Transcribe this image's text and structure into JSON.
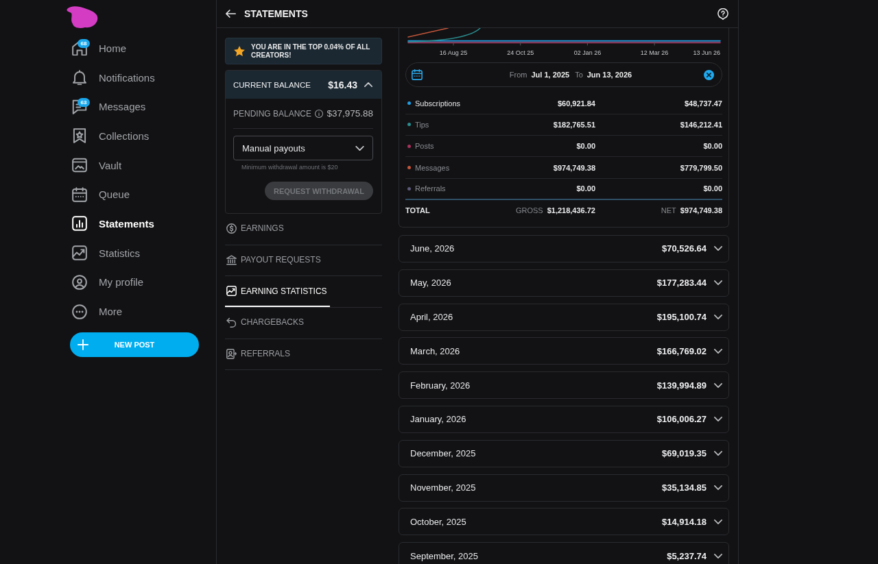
{
  "sidebar": {
    "items": [
      {
        "label": "Home",
        "badge": "68",
        "selected": false
      },
      {
        "label": "Notifications",
        "selected": false
      },
      {
        "label": "Messages",
        "badge": "63",
        "selected": false
      },
      {
        "label": "Collections",
        "selected": false
      },
      {
        "label": "Vault",
        "selected": false
      },
      {
        "label": "Queue",
        "selected": false
      },
      {
        "label": "Statements",
        "selected": true
      },
      {
        "label": "Statistics",
        "selected": false
      },
      {
        "label": "My profile",
        "selected": false
      },
      {
        "label": "More",
        "selected": false
      }
    ],
    "new_post_button": {
      "label": "NEW POST"
    }
  },
  "header": {
    "title": "STATEMENTS"
  },
  "banner": {
    "text": "YOU ARE IN THE TOP 0.04% OF ALL CREATORS!"
  },
  "balance": {
    "current_label": "CURRENT BALANCE",
    "current_amount": "$16.43",
    "expanded": true,
    "pending_label": "PENDING BALANCE",
    "pending_amount": "$37,975.88",
    "payout_select": {
      "value": "Manual payouts"
    },
    "hint": "Minimum withdrawal amount is $20",
    "withdraw_button": {
      "label": "REQUEST WITHDRAWAL",
      "disabled": true
    }
  },
  "tabs": [
    {
      "label": "EARNINGS",
      "selected": false
    },
    {
      "label": "PAYOUT REQUESTS",
      "selected": false
    },
    {
      "label": "EARNING STATISTICS",
      "selected": true
    },
    {
      "label": "CHARGEBACKS",
      "selected": false
    },
    {
      "label": "REFERRALS",
      "selected": false
    }
  ],
  "chart": {
    "tick_labels": [
      "16 Aug 25",
      "24 Oct 25",
      "02 Jan 26",
      "12 Mar 26",
      "13 Jun 26"
    ]
  },
  "date_range": {
    "from_label": "From",
    "from": "Jul 1, 2025",
    "to_label": "To",
    "to": "Jun 13, 2026"
  },
  "earnings_table": {
    "rows": [
      {
        "label": "Subscriptions",
        "color": "#1f9de3",
        "selected": true,
        "gross": "$60,921.84",
        "net": "$48,737.47"
      },
      {
        "label": "Tips",
        "color": "#2a8c8f",
        "selected": false,
        "gross": "$182,765.51",
        "net": "$146,212.41"
      },
      {
        "label": "Posts",
        "color": "#a8325c",
        "selected": false,
        "gross": "$0.00",
        "net": "$0.00"
      },
      {
        "label": "Messages",
        "color": "#c2553a",
        "selected": false,
        "gross": "$974,749.38",
        "net": "$779,799.50"
      },
      {
        "label": "Referrals",
        "color": "#5c5878",
        "selected": false,
        "gross": "$0.00",
        "net": "$0.00"
      }
    ],
    "total": {
      "label": "TOTAL",
      "gross_label": "GROSS",
      "gross": "$1,218,436.72",
      "net_label": "NET",
      "net": "$974,749.38"
    }
  },
  "months": [
    {
      "label": "June, 2026",
      "amount": "$70,526.64",
      "expanded": false
    },
    {
      "label": "May, 2026",
      "amount": "$177,283.44",
      "expanded": false
    },
    {
      "label": "April, 2026",
      "amount": "$195,100.74",
      "expanded": false
    },
    {
      "label": "March, 2026",
      "amount": "$166,769.02",
      "expanded": false
    },
    {
      "label": "February, 2026",
      "amount": "$139,994.89",
      "expanded": false
    },
    {
      "label": "January, 2026",
      "amount": "$106,006.27",
      "expanded": false
    },
    {
      "label": "December, 2025",
      "amount": "$69,019.35",
      "expanded": false
    },
    {
      "label": "November, 2025",
      "amount": "$35,134.85",
      "expanded": false
    },
    {
      "label": "October, 2025",
      "amount": "$14,914.18",
      "expanded": false
    },
    {
      "label": "September, 2025",
      "amount": "$5,237.74",
      "expanded": false
    }
  ]
}
